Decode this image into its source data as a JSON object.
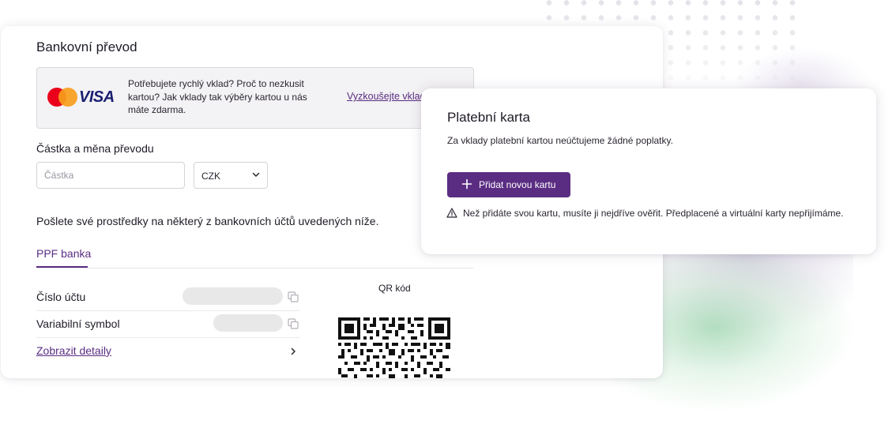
{
  "bank_transfer": {
    "title": "Bankovní převod",
    "promo": {
      "card_brands": [
        "mastercard-logo",
        "VISA"
      ],
      "text": "Potřebujete rychlý vklad? Proč to nezkusit kartou? Jak vklady tak výběry kartou u nás máte zdarma.",
      "link": "Vyzkoušejte vklad"
    },
    "amount_label": "Částka a měna převodu",
    "amount_placeholder": "Částka",
    "currency_selected": "CZK",
    "send_text": "Pošlete své prostředky na některý z bankovních účtů uvedených níže.",
    "tabs": [
      {
        "label": "PPF banka",
        "active": true
      }
    ],
    "rows": [
      {
        "label": "Číslo účtu"
      },
      {
        "label": "Variabilní symbol"
      }
    ],
    "details_link": "Zobrazit detaily",
    "qr_label": "QR kód"
  },
  "payment_card": {
    "title": "Platební karta",
    "description": "Za vklady platební kartou neúčtujeme žádné poplatky.",
    "add_button": "Přidat novou kartu",
    "warning": "Než přidáte svou kartu, musíte ji nejdříve ověřit. Předplacené a virtuální karty nepřijímáme."
  },
  "colors": {
    "accent": "#5a2d82",
    "mastercard_red": "#eb001b",
    "mastercard_orange": "#f79e1b",
    "visa_blue": "#1a1f71"
  },
  "icons": [
    "copy-icon",
    "chevron-down-icon",
    "chevron-right-icon",
    "plus-icon",
    "warning-icon",
    "qr-code"
  ]
}
